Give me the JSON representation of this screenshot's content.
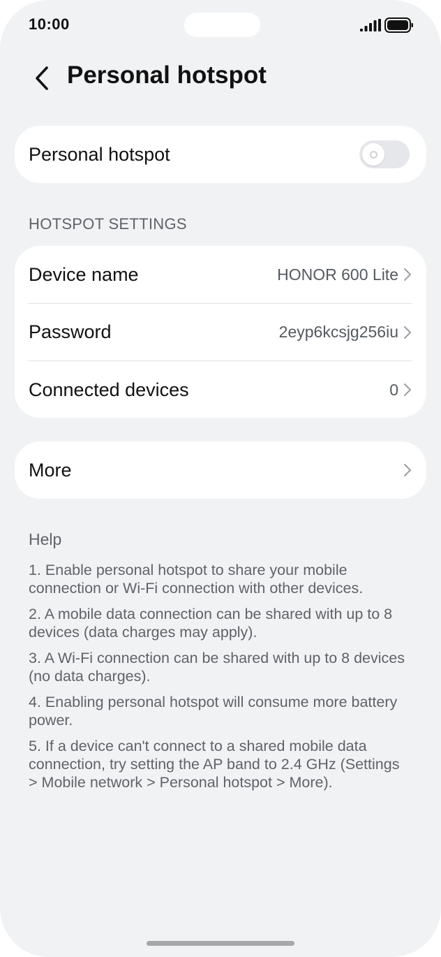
{
  "status_bar": {
    "time": "10:00",
    "signal_icon": "signal-icon",
    "battery_icon": "battery-icon"
  },
  "header": {
    "back_icon": "back-arrow-icon",
    "title": "Personal hotspot"
  },
  "hotspot_toggle": {
    "label": "Personal hotspot",
    "enabled": false
  },
  "settings": {
    "section_header": "HOTSPOT SETTINGS",
    "items": [
      {
        "label": "Device name",
        "value": "HONOR 600 Lite"
      },
      {
        "label": "Password",
        "value": "2eyp6kcsjg256iu"
      },
      {
        "label": "Connected devices",
        "value": "0"
      }
    ]
  },
  "more": {
    "label": "More"
  },
  "help": {
    "title": "Help",
    "items": [
      "1. Enable personal hotspot to share your mobile connection or Wi-Fi connection with other devices.",
      "2. A mobile data connection can be shared with up to 8 devices (data charges may apply).",
      "3. A Wi-Fi connection can be shared with up to 8 devices (no data charges).",
      "4. Enabling personal hotspot will consume more battery power.",
      "5. If a device can't connect to a shared mobile data connection, try setting the AP band to 2.4 GHz (Settings > Mobile network > Personal hotspot > More)."
    ]
  },
  "colors": {
    "background": "#f1f2f4",
    "card": "#ffffff",
    "primary_text": "#111111",
    "secondary_text": "#5f6368",
    "toggle_off": "#e6e7ea"
  }
}
